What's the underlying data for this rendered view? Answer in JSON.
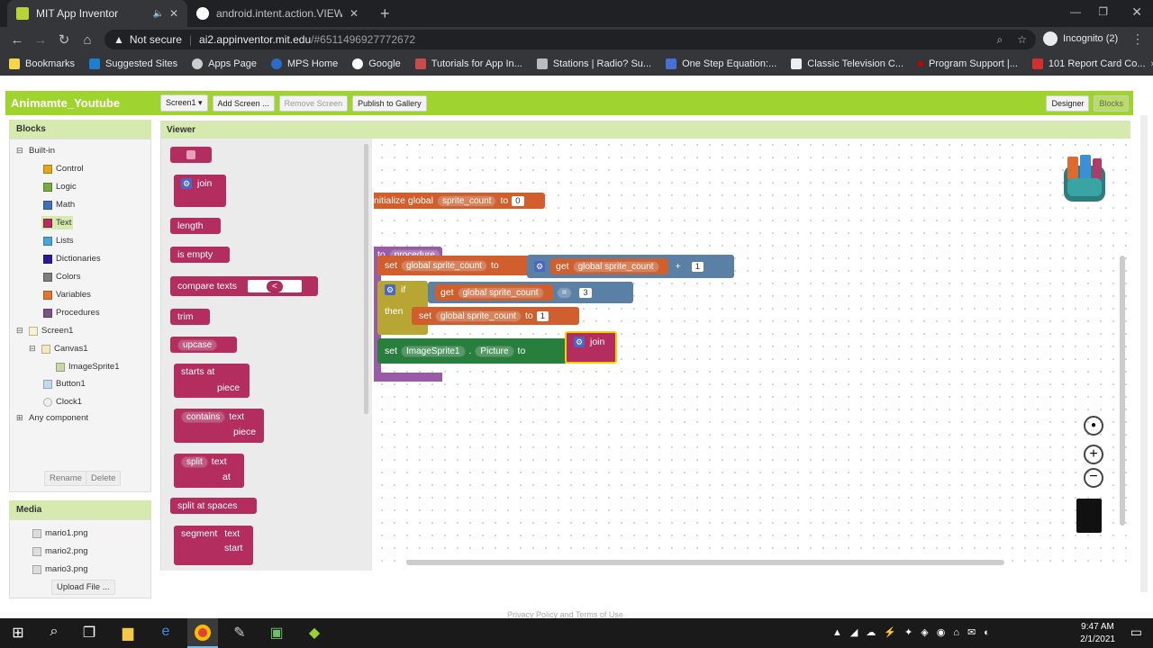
{
  "browser": {
    "tabs": [
      {
        "title": "MIT App Inventor",
        "active": true
      },
      {
        "title": "android.intent.action.VIEW - Goo",
        "active": false
      }
    ],
    "new_tab": "+",
    "address": {
      "security": "Not secure",
      "host": "ai2.appinventor.mit.edu",
      "path": "/#6511496927772672"
    },
    "profile": "Incognito (2)",
    "bookmarks": [
      "Bookmarks",
      "Suggested Sites",
      "Apps Page",
      "MPS Home",
      "Google",
      "Tutorials for App In...",
      "Stations | Radio? Su...",
      "One Step Equation:...",
      "Classic Television C...",
      "Program Support |...",
      "101 Report Card Co..."
    ]
  },
  "appinventor": {
    "project_title": "Animamte_Youtube",
    "toolbar": {
      "screen": "Screen1 ▾",
      "add_screen": "Add Screen ...",
      "remove_screen": "Remove Screen",
      "publish": "Publish to Gallery",
      "designer": "Designer",
      "blocks": "Blocks"
    },
    "blocks_panel": {
      "header": "Blocks",
      "builtin": "Built-in",
      "categories": [
        {
          "label": "Control",
          "color": "#e1a91a"
        },
        {
          "label": "Logic",
          "color": "#77ab41"
        },
        {
          "label": "Math",
          "color": "#3f71b5"
        },
        {
          "label": "Text",
          "color": "#b32d5e"
        },
        {
          "label": "Lists",
          "color": "#49a6d4"
        },
        {
          "label": "Dictionaries",
          "color": "#2d1799"
        },
        {
          "label": "Colors",
          "color": "#7d7d7d"
        },
        {
          "label": "Variables",
          "color": "#e0762f"
        },
        {
          "label": "Procedures",
          "color": "#7c5385"
        }
      ],
      "screen": "Screen1",
      "canvas": "Canvas1",
      "sprite": "ImageSprite1",
      "button": "Button1",
      "clock": "Clock1",
      "any": "Any component",
      "rename": "Rename",
      "delete": "Delete"
    },
    "media_panel": {
      "header": "Media",
      "files": [
        "mario1.png",
        "mario2.png",
        "mario3.png"
      ],
      "upload": "Upload File ..."
    },
    "viewer": {
      "header": "Viewer",
      "flyout": [
        "join",
        "length",
        "is empty",
        "compare texts",
        "trim",
        "upcase",
        "starts at",
        "contains",
        "split",
        "split at spaces",
        "segment"
      ],
      "flyout_extra": {
        "text": "text",
        "piece": "piece",
        "at": "at",
        "start": "start",
        "compare_op": "<"
      },
      "init_block": {
        "prefix": "nitialize global",
        "name": "sprite_count",
        "to": "to",
        "value": "0"
      },
      "procedure": {
        "to": "to",
        "name": "procedure"
      },
      "set1": {
        "set": "set",
        "var": "global sprite_count",
        "to": "to",
        "get": "get",
        "getvar": "global sprite_count",
        "plus": "+",
        "n": "1"
      },
      "if_block": {
        "if": "if",
        "get": "get",
        "var": "global sprite_count",
        "eq": "=",
        "n": "3",
        "then": "then",
        "set": "set",
        "setvar": "global sprite_count",
        "to": "to",
        "n2": "1"
      },
      "set2": {
        "set": "set",
        "comp": "ImageSprite1",
        "dot": ".",
        "prop": "Picture",
        "to": "to",
        "join": "join"
      }
    },
    "footer": "Privacy Policy and Terms of Use"
  },
  "taskbar": {
    "time": "9:47 AM",
    "date": "2/1/2021"
  }
}
